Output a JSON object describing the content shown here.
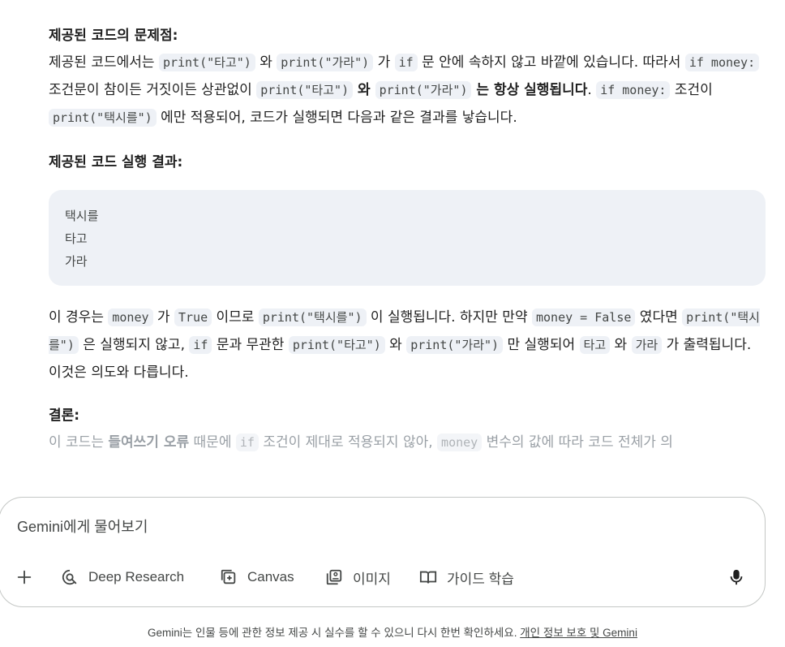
{
  "response": {
    "heading1": "제공된 코드의 문제점:",
    "p1": {
      "t1": "제공된 코드에서는 ",
      "c1": "print(\"타고\")",
      "t2": " 와 ",
      "c2": "print(\"가라\")",
      "t3": " 가 ",
      "c3": "if",
      "t4": " 문 안에 속하지 않고 바깥에 있습니다. 따라서 ",
      "c4": "if money:",
      "t5": " 조건문이 참이든 거짓이든 상관없이 ",
      "c5": "print(\"타고\")",
      "b1": " 와 ",
      "c6": "print(\"가라\")",
      "b2": " 는 항상 실행됩니다",
      "t6": ". ",
      "c7": "if money:",
      "t7": " 조건이 ",
      "c8": "print(\"택시를\")",
      "t8": " 에만 적용되어, 코드가 실행되면 다음과 같은 결과를 낳습니다."
    },
    "heading2": "제공된 코드 실행 결과:",
    "output_lines": [
      "택시를",
      "타고",
      "가라"
    ],
    "p2": {
      "t1": "이 경우는 ",
      "c1": "money",
      "t2": " 가 ",
      "c2": "True",
      "t3": " 이므로 ",
      "c3": "print(\"택시를\")",
      "t4": " 이 실행됩니다. 하지만 만약 ",
      "c4": "money = False",
      "t5": " 였다면 ",
      "c5": "print(\"택시를\")",
      "t6": " 은 실행되지 않고, ",
      "c6": "if",
      "t7": " 문과 무관한 ",
      "c7": "print(\"타고\")",
      "t8": " 와 ",
      "c8": "print(\"가라\")",
      "t9": " 만 실행되어 ",
      "c9": "타고",
      "t10": " 와 ",
      "c10": "가라",
      "t11": " 가 출력됩니다. 이것은 의도와 다릅니다."
    },
    "heading3": "결론:",
    "p3": {
      "t1": "이 코드는 ",
      "b1": "들여쓰기 오류",
      "t2": " 때문에 ",
      "c1": "if",
      "t3": " 조건이 제대로 적용되지 않아, ",
      "c2": "money",
      "t4": " 변수의 값에 따라 코드 전체가 의"
    }
  },
  "input": {
    "placeholder": "Gemini에게 물어보기",
    "tools": [
      {
        "label": "Deep Research",
        "icon": "deep-research-icon"
      },
      {
        "label": "Canvas",
        "icon": "canvas-icon"
      },
      {
        "label": "이미지",
        "icon": "image-icon"
      },
      {
        "label": "가이드 학습",
        "icon": "guided-learning-icon"
      }
    ]
  },
  "footer": {
    "text": "Gemini는 인물 등에 관한 정보 제공 시 실수를 할 수 있으니 다시 한번 확인하세요. ",
    "link": "개인 정보 보호 및 Gemini"
  }
}
